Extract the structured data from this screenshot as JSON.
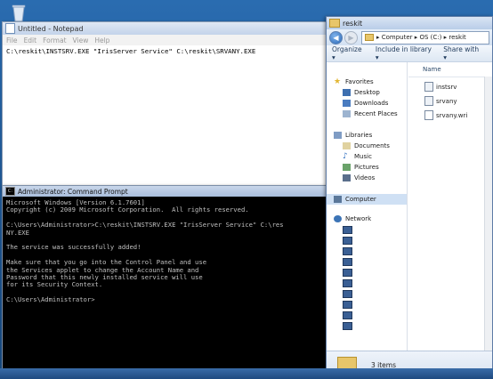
{
  "notepad": {
    "title": "Untitled - Notepad",
    "menu": [
      "File",
      "Edit",
      "Format",
      "View",
      "Help"
    ],
    "content": "C:\\reskit\\INSTSRV.EXE \"IrisServer Service\" C:\\reskit\\SRVANY.EXE"
  },
  "cmd": {
    "title": "Administrator: Command Prompt",
    "lines": [
      "Microsoft Windows [Version 6.1.7601]",
      "Copyright (c) 2009 Microsoft Corporation.  All rights reserved.",
      "",
      "C:\\Users\\Administrator>C:\\reskit\\INSTSRV.EXE \"IrisServer Service\" C:\\res",
      "NY.EXE",
      "",
      "The service was successfully added!",
      "",
      "Make sure that you go into the Control Panel and use",
      "the Services applet to change the Account Name and",
      "Password that this newly installed service will use",
      "for its Security Context.",
      "",
      "C:\\Users\\Administrator>"
    ]
  },
  "explorer": {
    "title": "reskit",
    "address": "▸ Computer ▸ OS (C:) ▸ reskit",
    "toolbar": {
      "organize": "Organize ▾",
      "include": "Include in library ▾",
      "share": "Share with ▾"
    },
    "nav": {
      "favorites": "Favorites",
      "desktop": "Desktop",
      "downloads": "Downloads",
      "recent": "Recent Places",
      "libraries": "Libraries",
      "documents": "Documents",
      "music": "Music",
      "pictures": "Pictures",
      "videos": "Videos",
      "computer": "Computer",
      "network": "Network"
    },
    "column": "Name",
    "files": [
      "instsrv",
      "srvany",
      "srvany.wri"
    ],
    "status": "3 items"
  },
  "colors": {
    "desktop": "#1e5a9c",
    "cmd_bg": "#000000",
    "cmd_fg": "#c0c0c0"
  },
  "icons": [
    "recycle-bin-icon",
    "notepad-icon",
    "cmd-icon",
    "folder-icon",
    "back-arrow-icon",
    "forward-arrow-icon",
    "star-icon",
    "library-icon",
    "computer-icon",
    "network-icon",
    "file-icon"
  ]
}
